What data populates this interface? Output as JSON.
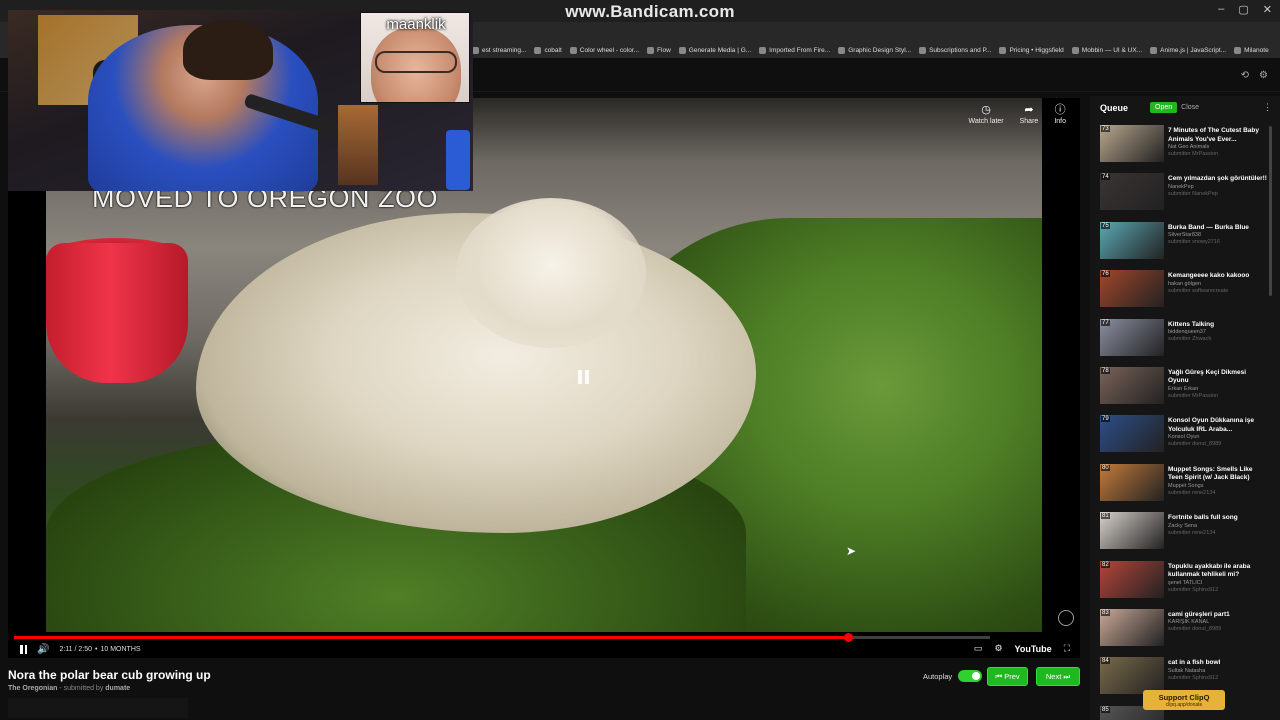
{
  "browser": {
    "watermark": "www.Bandicam.com",
    "bookmarks": [
      "est streaming...",
      "cobalt",
      "Color wheel - color...",
      "Flow",
      "Generate Media | G...",
      "Imported From Fire...",
      "Graphic Design Styl...",
      "Subscriptions and P...",
      "Pricing • Higgsfield",
      "Mobbin — UI & UX...",
      "Anime.js | JavaScript...",
      "Milanote"
    ],
    "window_controls": [
      "–",
      "▢",
      "✕"
    ]
  },
  "webcam": {
    "guest_label": "maanklik"
  },
  "player": {
    "caption": "MOVED TO OREGON ZOO",
    "time": "2:11 / 2:50",
    "separator": "•",
    "age": "10 MONTHS",
    "progress_fraction": 0.855,
    "brand": "YouTube",
    "actions": [
      {
        "icon": "clock-icon",
        "label": "Watch later"
      },
      {
        "icon": "share-icon",
        "label": "Share"
      },
      {
        "icon": "info-icon",
        "label": "Info"
      }
    ]
  },
  "video": {
    "title": "Nora the polar bear cub growing up",
    "channel": "The Oregonian",
    "submitted_prefix": "submitted by",
    "submitted_by": "dumate"
  },
  "controls": {
    "autoplay_label": "Autoplay",
    "autoplay_on": true,
    "prev_label": "⏮ Prev",
    "next_label": "Next ⏭"
  },
  "queue": {
    "title": "Queue",
    "open_label": "Open",
    "close_label": "Close",
    "items": [
      {
        "num": "73",
        "title": "7 Minutes of The Cutest Baby Animals You've Ever...",
        "channel": "Nat Geo Animals",
        "submitter": "submitter MrPassion",
        "color": "#b9a78e"
      },
      {
        "num": "74",
        "title": "Cem yılmazdan şok görüntüler!!",
        "channel": "NanekPep",
        "submitter": "submitter NanekPep",
        "color": "#3b3434"
      },
      {
        "num": "75",
        "title": "Burka Band — Burka Blue",
        "channel": "SilverStar838",
        "submitter": "submitter snowy2716",
        "color": "#5aa8b3"
      },
      {
        "num": "76",
        "title": "Kemangeeee kako kakooo",
        "channel": "hakan gölgen",
        "submitter": "submitter softwarecreate",
        "color": "#a2462a"
      },
      {
        "num": "77",
        "title": "Kittens Talking",
        "channel": "biddenqueen37",
        "submitter": "submitter Zhwach",
        "color": "#8b8fa0"
      },
      {
        "num": "78",
        "title": "Yağlı Güreş Keçi Dikmesi Oyunu",
        "channel": "Erkan Erkan",
        "submitter": "submitter MrPassion",
        "color": "#7a6258"
      },
      {
        "num": "79",
        "title": "Konsol Oyun Dükkanına işe Yolculuk IRL Araba...",
        "channel": "Konsol Oyun",
        "submitter": "submitter donut_8989",
        "color": "#2d4e8a"
      },
      {
        "num": "80",
        "title": "Muppet Songs: Smells Like Teen Spirit (w/ Jack Black)",
        "channel": "Muppet Songs",
        "submitter": "submitter rene2134",
        "color": "#c47a3a"
      },
      {
        "num": "81",
        "title": "Fortnite balls full song",
        "channel": "Zacky Sena",
        "submitter": "submitter rene2134",
        "color": "#d9d2cc"
      },
      {
        "num": "82",
        "title": "Topuklu ayakkabı ile araba kullanmak tehlikeli mi?",
        "channel": "şenel TATLICI",
        "submitter": "submitter Sphinx912",
        "color": "#b5453a"
      },
      {
        "num": "83",
        "title": "cami güreşleri part1",
        "channel": "KARIŞIK KANAL",
        "submitter": "submitter donut_8989",
        "color": "#c9a896"
      },
      {
        "num": "84",
        "title": "cat in a fish bowl",
        "channel": "Sultak Natasha",
        "submitter": "submitter Sphinx912",
        "color": "#7a6a4a"
      },
      {
        "num": "85",
        "title": "",
        "channel": "",
        "submitter": "",
        "color": "#555"
      }
    ]
  },
  "support": {
    "label": "Support ClipQ",
    "url": "clipq.app/donate"
  }
}
